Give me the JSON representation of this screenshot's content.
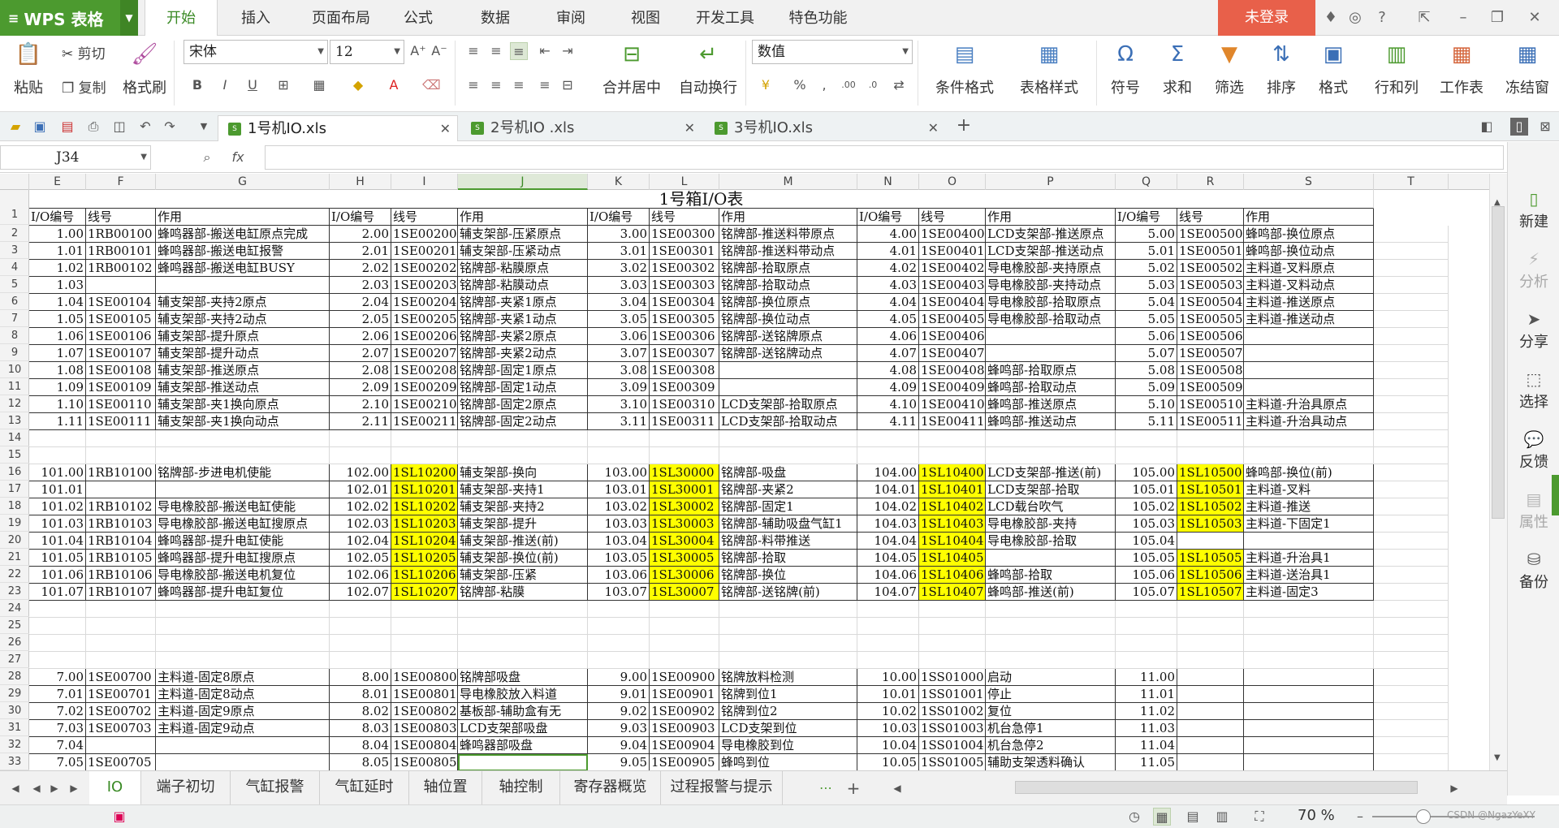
{
  "app": {
    "name": "WPS 表格",
    "login": "未登录"
  },
  "menu": [
    "开始",
    "插入",
    "页面布局",
    "公式",
    "数据",
    "审阅",
    "视图",
    "开发工具",
    "特色功能"
  ],
  "ribbon": {
    "paste": "粘贴",
    "cut": "剪切",
    "copy": "复制",
    "format_painter": "格式刷",
    "font": "宋体",
    "size": "12",
    "merge": "合并居中",
    "wrap": "自动换行",
    "numfmt": "数值",
    "cond": "条件格式",
    "table_style": "表格样式",
    "symbol": "符号",
    "sum": "求和",
    "filter": "筛选",
    "sort": "排序",
    "format": "格式",
    "rowcol": "行和列",
    "sheet": "工作表",
    "freeze": "冻结窗"
  },
  "docs": [
    "1号机IO.xls",
    "2号机IO .xls",
    "3号机IO.xls"
  ],
  "namebox": "J34",
  "fx": "fx",
  "columns": [
    "E",
    "F",
    "G",
    "H",
    "I",
    "J",
    "K",
    "L",
    "M",
    "N",
    "O",
    "P",
    "Q",
    "R",
    "S",
    "T"
  ],
  "title": "1号箱I/O表",
  "header": [
    "I/O编号",
    "线号",
    "作用",
    "I/O编号",
    "线号",
    "作用",
    "I/O编号",
    "线号",
    "作用",
    "I/O编号",
    "线号",
    "作用",
    "I/O编号",
    "线号",
    "作用"
  ],
  "rows": [
    {
      "r": "3",
      "c": [
        "1.00",
        "1RB00100",
        "蜂鸣器部-搬送电缸原点完成",
        "2.00",
        "1SE00200",
        "辅支架部-压紧原点",
        "3.00",
        "1SE00300",
        "铭牌部-推送料带原点",
        "4.00",
        "1SE00400",
        "LCD支架部-推送原点",
        "5.00",
        "1SE00500",
        "蜂鸣部-换位原点"
      ]
    },
    {
      "r": "4",
      "c": [
        "1.01",
        "1RB00101",
        "蜂鸣器部-搬送电缸报警",
        "2.01",
        "1SE00201",
        "辅支架部-压紧动点",
        "3.01",
        "1SE00301",
        "铭牌部-推送料带动点",
        "4.01",
        "1SE00401",
        "LCD支架部-推送动点",
        "5.01",
        "1SE00501",
        "蜂鸣部-换位动点"
      ]
    },
    {
      "r": "5",
      "c": [
        "1.02",
        "1RB00102",
        "蜂鸣器部-搬送电缸BUSY",
        "2.02",
        "1SE00202",
        "铭牌部-粘膜原点",
        "3.02",
        "1SE00302",
        "铭牌部-拾取原点",
        "4.02",
        "1SE00402",
        "导电橡胶部-夹持原点",
        "5.02",
        "1SE00502",
        "主料道-叉料原点"
      ]
    },
    {
      "r": "6",
      "c": [
        "1.03",
        "",
        "",
        "2.03",
        "1SE00203",
        "铭牌部-粘膜动点",
        "3.03",
        "1SE00303",
        "铭牌部-拾取动点",
        "4.03",
        "1SE00403",
        "导电橡胶部-夹持动点",
        "5.03",
        "1SE00503",
        "主料道-叉料动点"
      ]
    },
    {
      "r": "7",
      "c": [
        "1.04",
        "1SE00104",
        "辅支架部-夹持2原点",
        "2.04",
        "1SE00204",
        "铭牌部-夹紧1原点",
        "3.04",
        "1SE00304",
        "铭牌部-换位原点",
        "4.04",
        "1SE00404",
        "导电橡胶部-拾取原点",
        "5.04",
        "1SE00504",
        "主料道-推送原点"
      ]
    },
    {
      "r": "8",
      "c": [
        "1.05",
        "1SE00105",
        "辅支架部-夹持2动点",
        "2.05",
        "1SE00205",
        "铭牌部-夹紧1动点",
        "3.05",
        "1SE00305",
        "铭牌部-换位动点",
        "4.05",
        "1SE00405",
        "导电橡胶部-拾取动点",
        "5.05",
        "1SE00505",
        "主料道-推送动点"
      ]
    },
    {
      "r": "9",
      "c": [
        "1.06",
        "1SE00106",
        "辅支架部-提升原点",
        "2.06",
        "1SE00206",
        "铭牌部-夹紧2原点",
        "3.06",
        "1SE00306",
        "铭牌部-送铭牌原点",
        "4.06",
        "1SE00406",
        "",
        "5.06",
        "1SE00506",
        ""
      ]
    },
    {
      "r": "10",
      "c": [
        "1.07",
        "1SE00107",
        "辅支架部-提升动点",
        "2.07",
        "1SE00207",
        "铭牌部-夹紧2动点",
        "3.07",
        "1SE00307",
        "铭牌部-送铭牌动点",
        "4.07",
        "1SE00407",
        "",
        "5.07",
        "1SE00507",
        ""
      ]
    },
    {
      "r": "11",
      "c": [
        "1.08",
        "1SE00108",
        "辅支架部-推送原点",
        "2.08",
        "1SE00208",
        "铭牌部-固定1原点",
        "3.08",
        "1SE00308",
        "",
        "4.08",
        "1SE00408",
        "蜂鸣部-拾取原点",
        "5.08",
        "1SE00508",
        ""
      ]
    },
    {
      "r": "12",
      "c": [
        "1.09",
        "1SE00109",
        "辅支架部-推送动点",
        "2.09",
        "1SE00209",
        "铭牌部-固定1动点",
        "3.09",
        "1SE00309",
        "",
        "4.09",
        "1SE00409",
        "蜂鸣部-拾取动点",
        "5.09",
        "1SE00509",
        ""
      ]
    },
    {
      "r": "13",
      "c": [
        "1.10",
        "1SE00110",
        "辅支架部-夹1换向原点",
        "2.10",
        "1SE00210",
        "铭牌部-固定2原点",
        "3.10",
        "1SE00310",
        "LCD支架部-拾取原点",
        "4.10",
        "1SE00410",
        "蜂鸣部-推送原点",
        "5.10",
        "1SE00510",
        "主料道-升治具原点"
      ]
    },
    {
      "r": "14",
      "c": [
        "1.11",
        "1SE00111",
        "辅支架部-夹1换向动点",
        "2.11",
        "1SE00211",
        "铭牌部-固定2动点",
        "3.11",
        "1SE00311",
        "LCD支架部-拾取动点",
        "4.11",
        "1SE00411",
        "蜂鸣部-推送动点",
        "5.11",
        "1SE00511",
        "主料道-升治具动点"
      ]
    },
    {
      "r": "15",
      "c": [
        "",
        "",
        "",
        "",
        "",
        "",
        "",
        "",
        "",
        "",
        "",
        "",
        "",
        "",
        ""
      ]
    },
    {
      "r": "16",
      "c": [
        "",
        "",
        "",
        "",
        "",
        "",
        "",
        "",
        "",
        "",
        "",
        "",
        "",
        "",
        ""
      ]
    },
    {
      "r": "17",
      "c": [
        "101.00",
        "1RB10100",
        "铭牌部-步进电机使能",
        "102.00",
        "1SL10200",
        "辅支架部-换向",
        "103.00",
        "1SL30000",
        "铭牌部-吸盘",
        "104.00",
        "1SL10400",
        "LCD支架部-推送(前)",
        "105.00",
        "1SL10500",
        "蜂鸣部-换位(前)"
      ]
    },
    {
      "r": "18",
      "c": [
        "101.01",
        "",
        "",
        "102.01",
        "1SL10201",
        "辅支架部-夹持1",
        "103.01",
        "1SL30001",
        "铭牌部-夹紧2",
        "104.01",
        "1SL10401",
        "LCD支架部-拾取",
        "105.01",
        "1SL10501",
        "主料道-叉料"
      ]
    },
    {
      "r": "19",
      "c": [
        "101.02",
        "1RB10102",
        "导电橡胶部-搬送电缸使能",
        "102.02",
        "1SL10202",
        "辅支架部-夹持2",
        "103.02",
        "1SL30002",
        "铭牌部-固定1",
        "104.02",
        "1SL10402",
        "LCD载台吹气",
        "105.02",
        "1SL10502",
        "主料道-推送"
      ]
    },
    {
      "r": "20",
      "c": [
        "101.03",
        "1RB10103",
        "导电橡胶部-搬送电缸搜原点",
        "102.03",
        "1SL10203",
        "辅支架部-提升",
        "103.03",
        "1SL30003",
        "铭牌部-辅助吸盘气缸1",
        "104.03",
        "1SL10403",
        "导电橡胶部-夹持",
        "105.03",
        "1SL10503",
        "主料道-下固定1"
      ]
    },
    {
      "r": "21",
      "c": [
        "101.04",
        "1RB10104",
        "蜂鸣器部-提升电缸使能",
        "102.04",
        "1SL10204",
        "辅支架部-推送(前)",
        "103.04",
        "1SL30004",
        "铭牌部-料带推送",
        "104.04",
        "1SL10404",
        "导电橡胶部-拾取",
        "105.04",
        "",
        ""
      ]
    },
    {
      "r": "22",
      "c": [
        "101.05",
        "1RB10105",
        "蜂鸣器部-提升电缸搜原点",
        "102.05",
        "1SL10205",
        "辅支架部-换位(前)",
        "103.05",
        "1SL30005",
        "铭牌部-拾取",
        "104.05",
        "1SL10405",
        "",
        "105.05",
        "1SL10505",
        "主料道-升治具1"
      ]
    },
    {
      "r": "23",
      "c": [
        "101.06",
        "1RB10106",
        "导电橡胶部-搬送电机复位",
        "102.06",
        "1SL10206",
        "辅支架部-压紧",
        "103.06",
        "1SL30006",
        "铭牌部-换位",
        "104.06",
        "1SL10406",
        "蜂鸣部-拾取",
        "105.06",
        "1SL10506",
        "主料道-送治具1"
      ]
    },
    {
      "r": "24",
      "c": [
        "101.07",
        "1RB10107",
        "蜂鸣器部-提升电缸复位",
        "102.07",
        "1SL10207",
        "铭牌部-粘膜",
        "103.07",
        "1SL30007",
        "铭牌部-送铭牌(前)",
        "104.07",
        "1SL10407",
        "蜂鸣部-推送(前)",
        "105.07",
        "1SL10507",
        "主料道-固定3"
      ]
    },
    {
      "r": "25",
      "c": [
        "",
        "",
        "",
        "",
        "",
        "",
        "",
        "",
        "",
        "",
        "",
        "",
        "",
        "",
        ""
      ]
    },
    {
      "r": "26",
      "c": [
        "",
        "",
        "",
        "",
        "",
        "",
        "",
        "",
        "",
        "",
        "",
        "",
        "",
        "",
        ""
      ]
    },
    {
      "r": "27",
      "c": [
        "",
        "",
        "",
        "",
        "",
        "",
        "",
        "",
        "",
        "",
        "",
        "",
        "",
        "",
        ""
      ]
    },
    {
      "r": "28",
      "c": [
        "",
        "",
        "",
        "",
        "",
        "",
        "",
        "",
        "",
        "",
        "",
        "",
        "",
        "",
        ""
      ]
    },
    {
      "r": "29",
      "c": [
        "7.00",
        "1SE00700",
        "主料道-固定8原点",
        "8.00",
        "1SE00800",
        "铭牌部吸盘",
        "9.00",
        "1SE00900",
        "铭牌放料检测",
        "10.00",
        "1SS01000",
        "启动",
        "11.00",
        "",
        ""
      ]
    },
    {
      "r": "30",
      "c": [
        "7.01",
        "1SE00701",
        "主料道-固定8动点",
        "8.01",
        "1SE00801",
        "导电橡胶放入料道",
        "9.01",
        "1SE00901",
        "铭牌到位1",
        "10.01",
        "1SS01001",
        "停止",
        "11.01",
        "",
        ""
      ]
    },
    {
      "r": "31",
      "c": [
        "7.02",
        "1SE00702",
        "主料道-固定9原点",
        "8.02",
        "1SE00802",
        "基板部-辅助盒有无",
        "9.02",
        "1SE00902",
        "铭牌到位2",
        "10.02",
        "1SS01002",
        "复位",
        "11.02",
        "",
        ""
      ]
    },
    {
      "r": "32",
      "c": [
        "7.03",
        "1SE00703",
        "主料道-固定9动点",
        "8.03",
        "1SE00803",
        "LCD支架部吸盘",
        "9.03",
        "1SE00903",
        "LCD支架到位",
        "10.03",
        "1SS01003",
        "机台急停1",
        "11.03",
        "",
        ""
      ]
    },
    {
      "r": "33",
      "c": [
        "7.04",
        "",
        "",
        "8.04",
        "1SE00804",
        "蜂鸣器部吸盘",
        "9.04",
        "1SE00904",
        "导电橡胶到位",
        "10.04",
        "1SS01004",
        "机台急停2",
        "11.04",
        "",
        ""
      ]
    },
    {
      "r": "34",
      "c": [
        "7.05",
        "1SE00705",
        "",
        "8.05",
        "1SE00805",
        "",
        "9.05",
        "1SE00905",
        "蜂鸣到位",
        "10.05",
        "1SS01005",
        "辅助支架透料确认",
        "11.05",
        "",
        ""
      ]
    }
  ],
  "sheets": [
    "IO",
    "端子初切",
    "气缸报警",
    "气缸延时",
    "轴位置",
    "轴控制",
    "寄存器概览",
    "过程报警与提示"
  ],
  "rightpanel": [
    "新建",
    "分析",
    "分享",
    "选择",
    "反馈",
    "属性",
    "备份"
  ],
  "status": {
    "zoom": "70 %",
    "watermark": "CSDN @NgazYeXY"
  }
}
